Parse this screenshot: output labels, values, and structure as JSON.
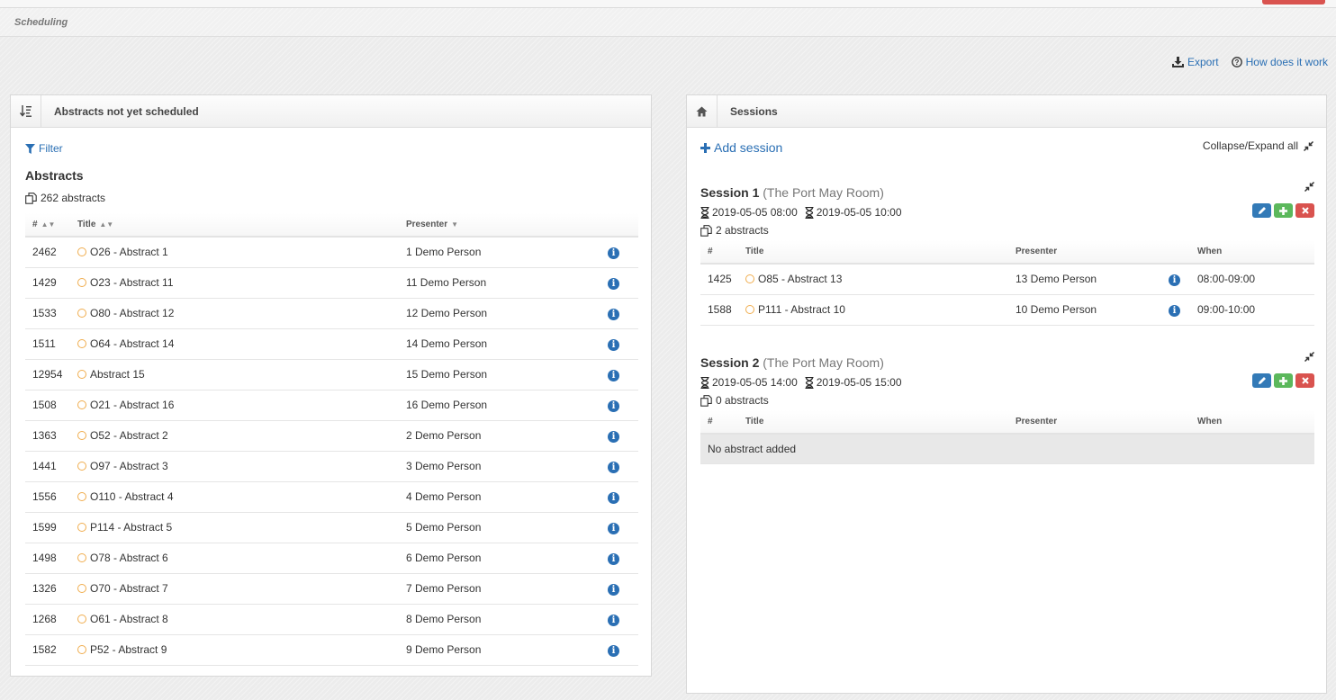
{
  "breadcrumb": "Scheduling",
  "toplinks": {
    "export": "Export",
    "how": "How does it work"
  },
  "left": {
    "title": "Abstracts not yet scheduled",
    "filter": "Filter",
    "heading": "Abstracts",
    "count": "262 abstracts",
    "columns": {
      "num": "#",
      "title": "Title",
      "presenter": "Presenter"
    },
    "rows": [
      {
        "id": "2462",
        "title": "O26 - Abstract 1",
        "presenter": "1 Demo Person"
      },
      {
        "id": "1429",
        "title": "O23 - Abstract 11",
        "presenter": "11 Demo Person"
      },
      {
        "id": "1533",
        "title": "O80 - Abstract 12",
        "presenter": "12 Demo Person"
      },
      {
        "id": "1511",
        "title": "O64 - Abstract 14",
        "presenter": "14 Demo Person"
      },
      {
        "id": "12954",
        "title": "Abstract 15",
        "presenter": "15 Demo Person"
      },
      {
        "id": "1508",
        "title": "O21 - Abstract 16",
        "presenter": "16 Demo Person"
      },
      {
        "id": "1363",
        "title": "O52 - Abstract 2",
        "presenter": "2 Demo Person"
      },
      {
        "id": "1441",
        "title": "O97 - Abstract 3",
        "presenter": "3 Demo Person"
      },
      {
        "id": "1556",
        "title": "O110 - Abstract 4",
        "presenter": "4 Demo Person"
      },
      {
        "id": "1599",
        "title": "P114 - Abstract 5",
        "presenter": "5 Demo Person"
      },
      {
        "id": "1498",
        "title": "O78 - Abstract 6",
        "presenter": "6 Demo Person"
      },
      {
        "id": "1326",
        "title": "O70 - Abstract 7",
        "presenter": "7 Demo Person"
      },
      {
        "id": "1268",
        "title": "O61 - Abstract 8",
        "presenter": "8 Demo Person"
      },
      {
        "id": "1582",
        "title": "P52 - Abstract 9",
        "presenter": "9 Demo Person"
      }
    ]
  },
  "right": {
    "title": "Sessions",
    "add_session": "Add session",
    "collapse_all": "Collapse/Expand all",
    "columns": {
      "num": "#",
      "title": "Title",
      "presenter": "Presenter",
      "when": "When"
    },
    "sessions": [
      {
        "name": "Session 1",
        "room": "(The Port May Room)",
        "start": "2019-05-05 08:00",
        "end": "2019-05-05 10:00",
        "count": "2 abstracts",
        "rows": [
          {
            "id": "1425",
            "title": "O85 - Abstract 13",
            "presenter": "13 Demo Person",
            "when": "08:00-09:00"
          },
          {
            "id": "1588",
            "title": "P111 - Abstract 10",
            "presenter": "10 Demo Person",
            "when": "09:00-10:00"
          }
        ]
      },
      {
        "name": "Session 2",
        "room": "(The Port May Room)",
        "start": "2019-05-05 14:00",
        "end": "2019-05-05 15:00",
        "count": "0 abstracts",
        "empty": "No abstract added",
        "rows": []
      }
    ]
  }
}
